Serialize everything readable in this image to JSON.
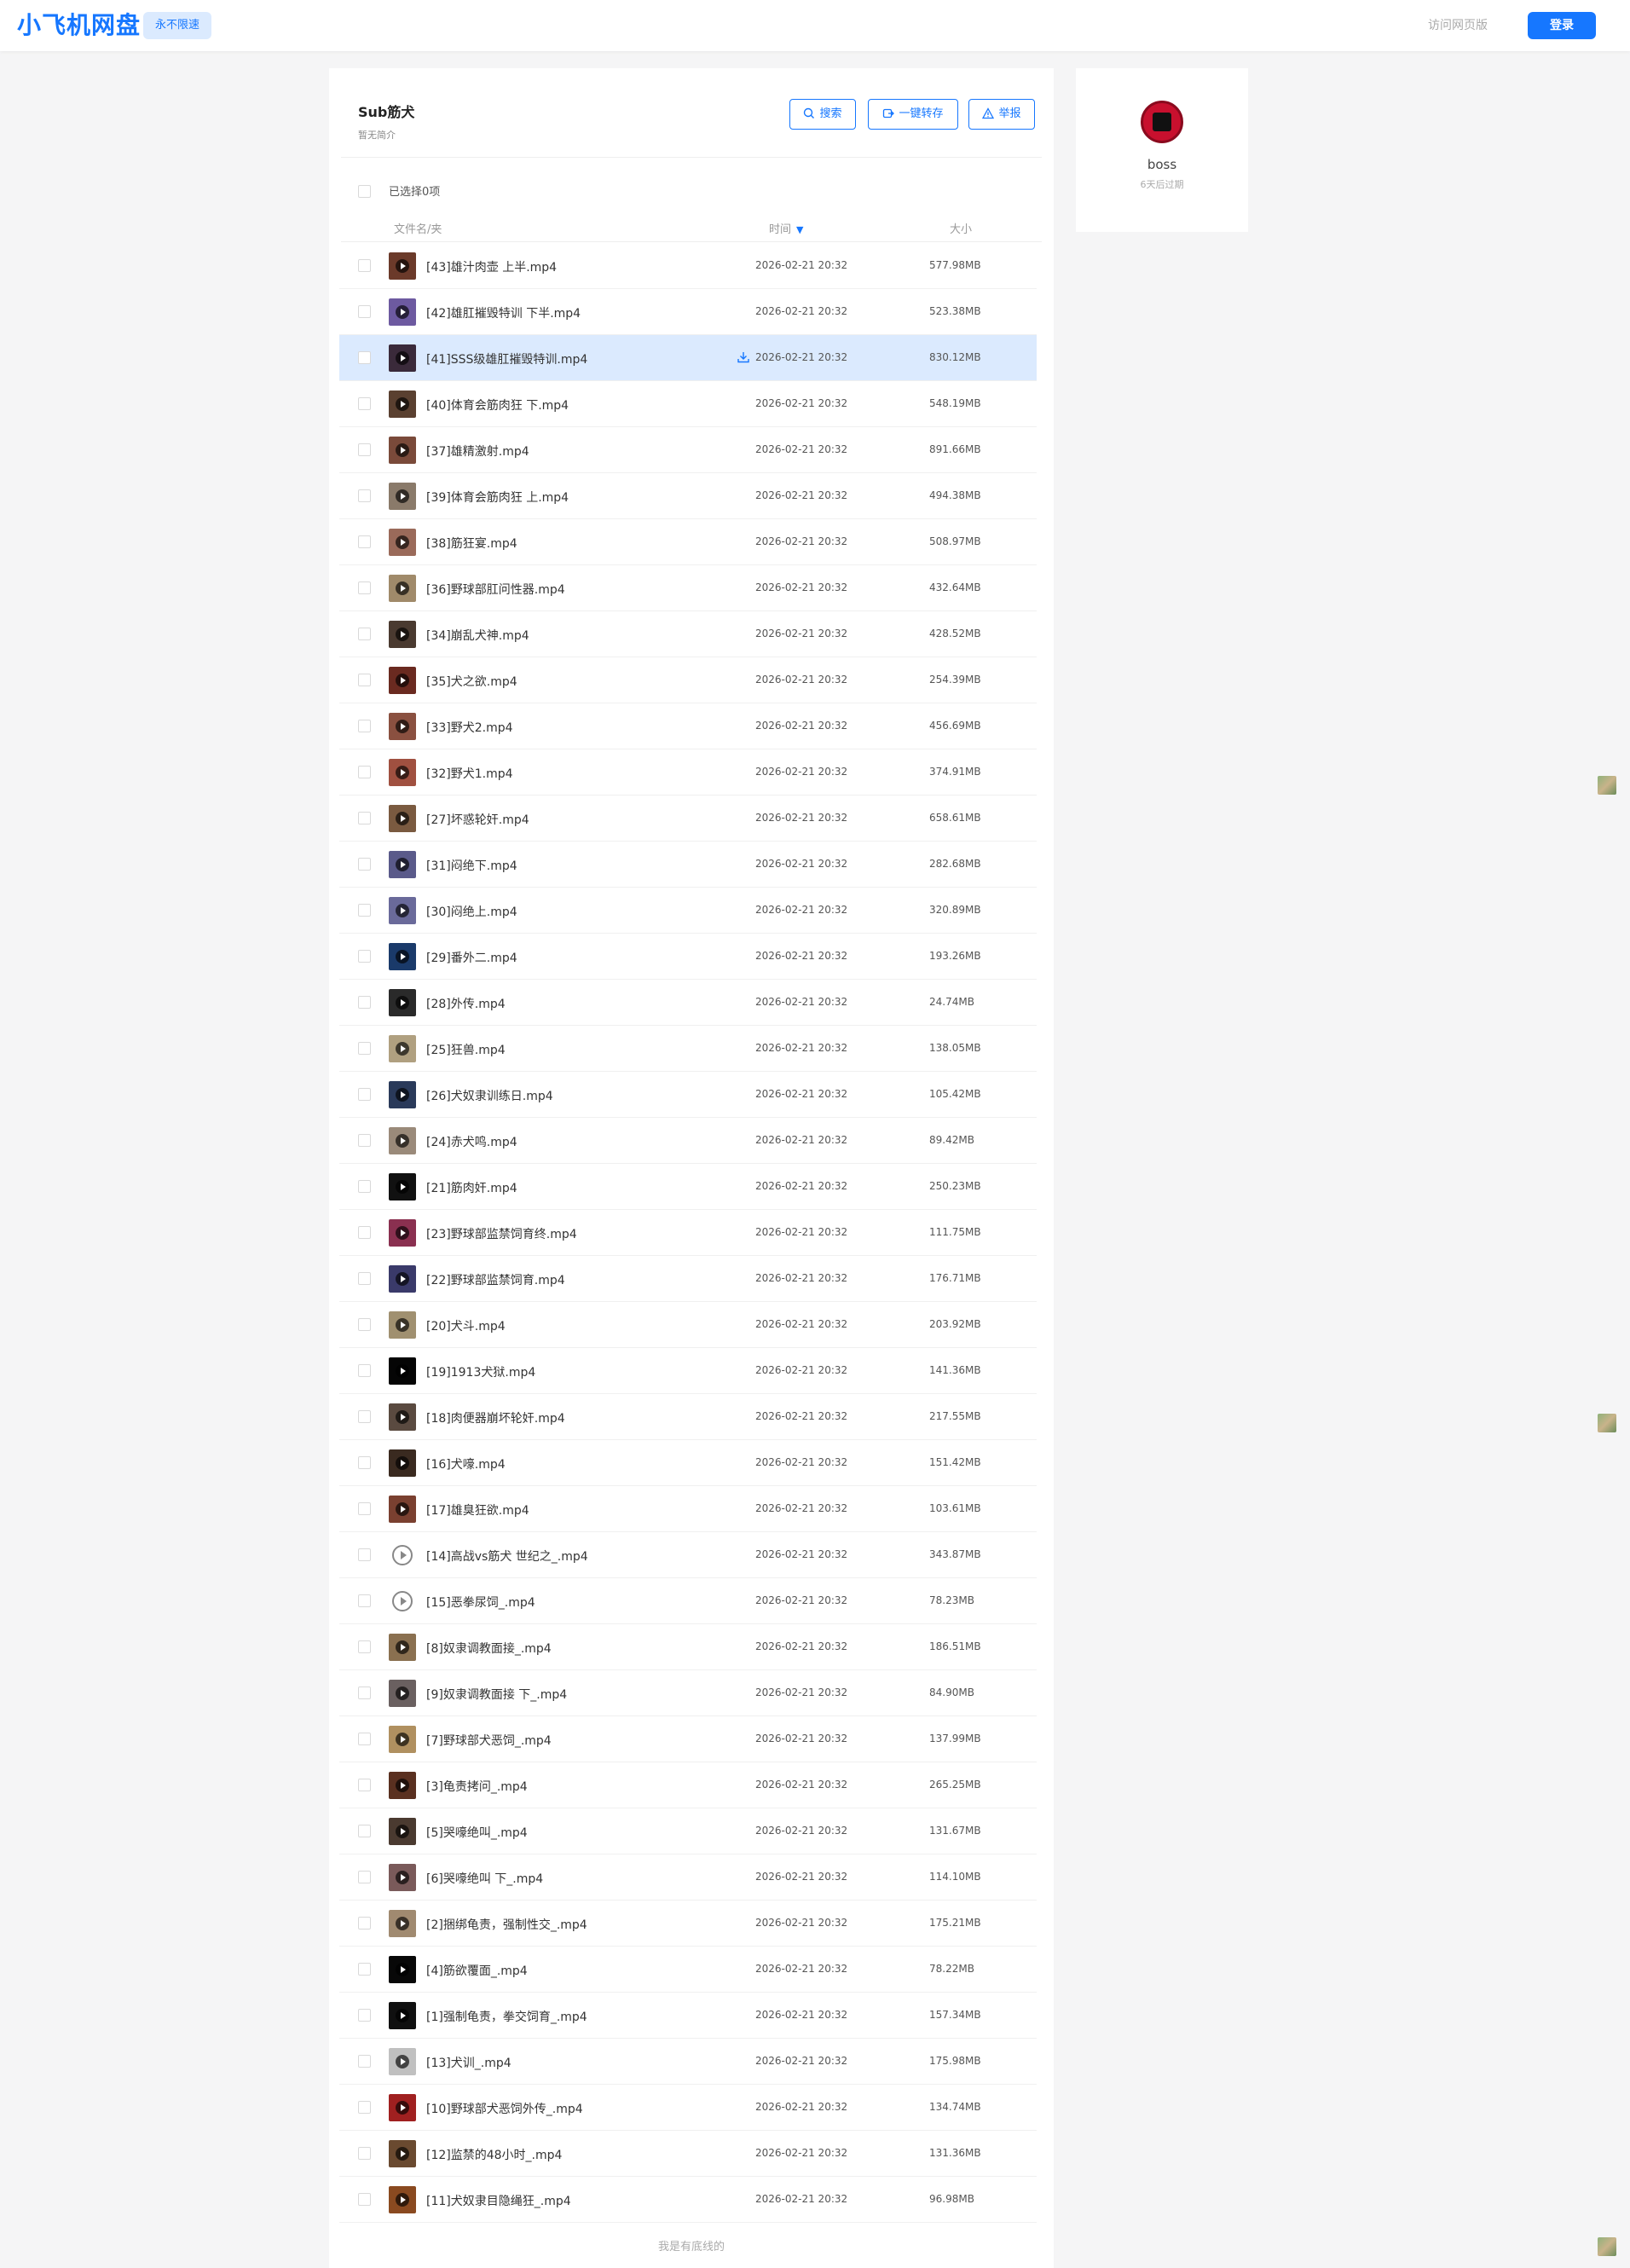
{
  "header": {
    "logo": "小飞机网盘",
    "speed_badge": "永不限速",
    "web_version": "访问网页版",
    "login": "登录"
  },
  "folder": {
    "title": "Sub筋犬",
    "description": "暂无简介",
    "actions": {
      "search": "搜索",
      "save_all": "一键转存",
      "report": "举报"
    },
    "selected_text": "已选择0项",
    "columns": {
      "name": "文件名/夹",
      "time": "时间",
      "size": "大小"
    },
    "sort_icon": "sort-desc-icon"
  },
  "files": [
    {
      "name": "[43]雄汁肉壶 上半.mp4",
      "time": "2026-02-21 20:32",
      "size": "577.98MB",
      "thumb": "#6b3a2a"
    },
    {
      "name": "[42]雄肛摧毁特训 下半.mp4",
      "time": "2026-02-21 20:32",
      "size": "523.38MB",
      "thumb": "#6d5aa0"
    },
    {
      "name": "[41]SSS级雄肛摧毁特训.mp4",
      "time": "2026-02-21 20:32",
      "size": "830.12MB",
      "thumb": "#3a2a3a"
    },
    {
      "name": "[40]体育会筋肉狂 下.mp4",
      "time": "2026-02-21 20:32",
      "size": "548.19MB",
      "thumb": "#5a4030"
    },
    {
      "name": "[37]雄精激射.mp4",
      "time": "2026-02-21 20:32",
      "size": "891.66MB",
      "thumb": "#7a4a3a"
    },
    {
      "name": "[39]体育会筋肉狂 上.mp4",
      "time": "2026-02-21 20:32",
      "size": "494.38MB",
      "thumb": "#8a7a6a"
    },
    {
      "name": "[38]筋狂宴.mp4",
      "time": "2026-02-21 20:32",
      "size": "508.97MB",
      "thumb": "#9a6a5a"
    },
    {
      "name": "[36]野球部肛问性器.mp4",
      "time": "2026-02-21 20:32",
      "size": "432.64MB",
      "thumb": "#a08a6a"
    },
    {
      "name": "[34]崩乱犬神.mp4",
      "time": "2026-02-21 20:32",
      "size": "428.52MB",
      "thumb": "#4a3a30"
    },
    {
      "name": "[35]犬之欲.mp4",
      "time": "2026-02-21 20:32",
      "size": "254.39MB",
      "thumb": "#6a2a20"
    },
    {
      "name": "[33]野犬2.mp4",
      "time": "2026-02-21 20:32",
      "size": "456.69MB",
      "thumb": "#8a5040"
    },
    {
      "name": "[32]野犬1.mp4",
      "time": "2026-02-21 20:32",
      "size": "374.91MB",
      "thumb": "#a05040"
    },
    {
      "name": "[27]坏惑轮奸.mp4",
      "time": "2026-02-21 20:32",
      "size": "658.61MB",
      "thumb": "#7a5a40"
    },
    {
      "name": "[31]闷绝下.mp4",
      "time": "2026-02-21 20:32",
      "size": "282.68MB",
      "thumb": "#5a5a8a"
    },
    {
      "name": "[30]闷绝上.mp4",
      "time": "2026-02-21 20:32",
      "size": "320.89MB",
      "thumb": "#6a6a9a"
    },
    {
      "name": "[29]番外二.mp4",
      "time": "2026-02-21 20:32",
      "size": "193.26MB",
      "thumb": "#1a3a6a"
    },
    {
      "name": "[28]外传.mp4",
      "time": "2026-02-21 20:32",
      "size": "24.74MB",
      "thumb": "#2a2a2a"
    },
    {
      "name": "[25]狂兽.mp4",
      "time": "2026-02-21 20:32",
      "size": "138.05MB",
      "thumb": "#b0a080"
    },
    {
      "name": "[26]犬奴隶训练日.mp4",
      "time": "2026-02-21 20:32",
      "size": "105.42MB",
      "thumb": "#2a3a5a"
    },
    {
      "name": "[24]赤犬鸣.mp4",
      "time": "2026-02-21 20:32",
      "size": "89.42MB",
      "thumb": "#9a8a7a"
    },
    {
      "name": "[21]筋肉奸.mp4",
      "time": "2026-02-21 20:32",
      "size": "250.23MB",
      "thumb": "#111111"
    },
    {
      "name": "[23]野球部监禁饲育终.mp4",
      "time": "2026-02-21 20:32",
      "size": "111.75MB",
      "thumb": "#8a3050"
    },
    {
      "name": "[22]野球部监禁饲育.mp4",
      "time": "2026-02-21 20:32",
      "size": "176.71MB",
      "thumb": "#3a3a6a"
    },
    {
      "name": "[20]犬斗.mp4",
      "time": "2026-02-21 20:32",
      "size": "203.92MB",
      "thumb": "#a09070"
    },
    {
      "name": "[19]1913犬狱.mp4",
      "time": "2026-02-21 20:32",
      "size": "141.36MB",
      "thumb": "#050505"
    },
    {
      "name": "[18]肉便器崩坏轮奸.mp4",
      "time": "2026-02-21 20:32",
      "size": "217.55MB",
      "thumb": "#5a4a40"
    },
    {
      "name": "[16]犬嚎.mp4",
      "time": "2026-02-21 20:32",
      "size": "151.42MB",
      "thumb": "#3a2a20"
    },
    {
      "name": "[17]雄臭狂欲.mp4",
      "time": "2026-02-21 20:32",
      "size": "103.61MB",
      "thumb": "#7a4030"
    },
    {
      "name": "[14]高战vs筋犬 世纪之_.mp4",
      "time": "2026-02-21 20:32",
      "size": "343.87MB",
      "thumb": "circle"
    },
    {
      "name": "[15]恶拳尿饲_.mp4",
      "time": "2026-02-21 20:32",
      "size": "78.23MB",
      "thumb": "circle"
    },
    {
      "name": "[8]奴隶调教面接_.mp4",
      "time": "2026-02-21 20:32",
      "size": "186.51MB",
      "thumb": "#8a7050"
    },
    {
      "name": "[9]奴隶调教面接 下_.mp4",
      "time": "2026-02-21 20:32",
      "size": "84.90MB",
      "thumb": "#6a6060"
    },
    {
      "name": "[7]野球部犬恶饲_.mp4",
      "time": "2026-02-21 20:32",
      "size": "137.99MB",
      "thumb": "#b09060"
    },
    {
      "name": "[3]龟责拷问_.mp4",
      "time": "2026-02-21 20:32",
      "size": "265.25MB",
      "thumb": "#5a3020"
    },
    {
      "name": "[5]哭嚎绝叫_.mp4",
      "time": "2026-02-21 20:32",
      "size": "131.67MB",
      "thumb": "#4a3a30"
    },
    {
      "name": "[6]哭嚎绝叫 下_.mp4",
      "time": "2026-02-21 20:32",
      "size": "114.10MB",
      "thumb": "#7a5a5a"
    },
    {
      "name": "[2]捆绑龟责，强制性交_.mp4",
      "time": "2026-02-21 20:32",
      "size": "175.21MB",
      "thumb": "#a08a70"
    },
    {
      "name": "[4]筋欲覆面_.mp4",
      "time": "2026-02-21 20:32",
      "size": "78.22MB",
      "thumb": "#080808"
    },
    {
      "name": "[1]强制龟责，拳交饲育_.mp4",
      "time": "2026-02-21 20:32",
      "size": "157.34MB",
      "thumb": "#101010"
    },
    {
      "name": "[13]犬训_.mp4",
      "time": "2026-02-21 20:32",
      "size": "175.98MB",
      "thumb": "#c0c0c0"
    },
    {
      "name": "[10]野球部犬恶饲外传_.mp4",
      "time": "2026-02-21 20:32",
      "size": "134.74MB",
      "thumb": "#a02020"
    },
    {
      "name": "[12]监禁的48小时_.mp4",
      "time": "2026-02-21 20:32",
      "size": "131.36MB",
      "thumb": "#6a4a30"
    },
    {
      "name": "[11]犬奴隶目隐绳狂_.mp4",
      "time": "2026-02-21 20:32",
      "size": "96.98MB",
      "thumb": "#8a4a20"
    }
  ],
  "highlighted_row": 2,
  "footer_note": "我是有底线的",
  "user": {
    "name": "boss",
    "expire": "6天后过期"
  }
}
